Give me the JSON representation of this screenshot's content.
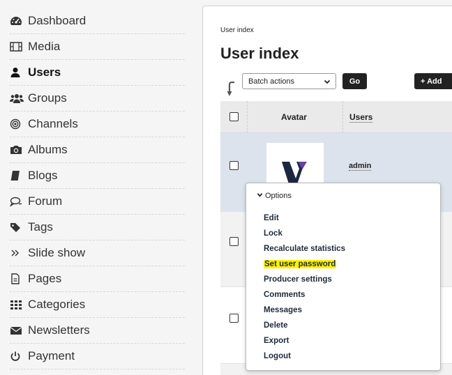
{
  "sidebar": {
    "items": [
      {
        "label": "Dashboard",
        "icon": "dashboard-icon"
      },
      {
        "label": "Media",
        "icon": "film-icon"
      },
      {
        "label": "Users",
        "icon": "user-icon",
        "active": true
      },
      {
        "label": "Groups",
        "icon": "users-icon"
      },
      {
        "label": "Channels",
        "icon": "channels-icon"
      },
      {
        "label": "Albums",
        "icon": "camera-icon"
      },
      {
        "label": "Blogs",
        "icon": "book-icon"
      },
      {
        "label": "Forum",
        "icon": "forum-icon"
      },
      {
        "label": "Tags",
        "icon": "tags-icon"
      },
      {
        "label": "Slide show",
        "icon": "double-chevron-icon"
      },
      {
        "label": "Pages",
        "icon": "page-icon"
      },
      {
        "label": "Categories",
        "icon": "grid-icon"
      },
      {
        "label": "Newsletters",
        "icon": "envelope-icon"
      },
      {
        "label": "Payment",
        "icon": "power-icon"
      }
    ]
  },
  "main": {
    "breadcrumb": "User index",
    "title": "User index",
    "batch_select": {
      "selected": "Batch actions"
    },
    "go_label": "Go",
    "add_label": "+ Add",
    "table": {
      "headers": {
        "avatar": "Avatar",
        "users": "Users"
      },
      "rows": [
        {
          "username": "admin"
        }
      ]
    }
  },
  "popup": {
    "header": "Options",
    "items": [
      "Edit",
      "Lock",
      "Recalculate statistics",
      "Set user password",
      "Producer settings",
      "Comments",
      "Messages",
      "Delete",
      "Export",
      "Logout"
    ],
    "highlighted": "Set user password"
  },
  "colors": {
    "accent_dark": "#222222",
    "row_selected": "#dde3ec",
    "highlight": "#fff200",
    "logo_navy": "#1c2741",
    "logo_purple": "#6b3fa0"
  }
}
